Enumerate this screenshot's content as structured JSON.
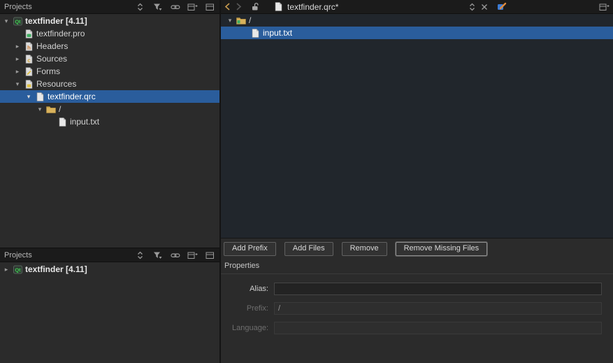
{
  "left_panel": {
    "title": "Projects",
    "tree": [
      {
        "label": "textfinder [4.11]"
      },
      {
        "label": "textfinder.pro"
      },
      {
        "label": "Headers"
      },
      {
        "label": "Sources"
      },
      {
        "label": "Forms"
      },
      {
        "label": "Resources"
      },
      {
        "label": "textfinder.qrc"
      },
      {
        "label": "/"
      },
      {
        "label": "input.txt"
      }
    ]
  },
  "bottom_panel": {
    "title": "Projects",
    "tree": [
      {
        "label": "textfinder [4.11]"
      }
    ]
  },
  "editor": {
    "document_title": "textfinder.qrc*",
    "tree": [
      {
        "label": "/"
      },
      {
        "label": "input.txt"
      }
    ],
    "buttons": {
      "add_prefix": "Add Prefix",
      "add_files": "Add Files",
      "remove": "Remove",
      "remove_missing": "Remove Missing Files"
    },
    "properties": {
      "title": "Properties",
      "alias_label": "Alias:",
      "alias_value": "",
      "prefix_label": "Prefix:",
      "prefix_value": "/",
      "language_label": "Language:",
      "language_value": ""
    }
  }
}
